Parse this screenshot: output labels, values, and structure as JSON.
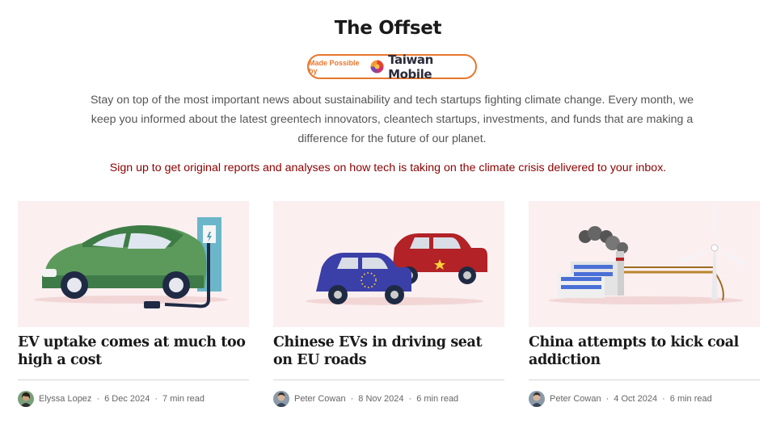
{
  "header": {
    "title": "The Offset",
    "sponsor": {
      "prefix": "Made Possible by",
      "brand": "Taiwan Mobile"
    }
  },
  "intro": "Stay on top of the most important news about sustainability and tech startups fighting climate change. Every month, we keep you informed about the latest greentech innovators, cleantech startups, investments, and funds that are making a difference for the future of our planet.",
  "cta": "Sign up to get original reports and analyses on how tech is taking on the climate crisis delivered to your inbox.",
  "articles": [
    {
      "headline": "EV uptake comes at much too high a cost",
      "author": "Elyssa Lopez",
      "date": "6 Dec 2024",
      "read_time": "7 min read",
      "sep": "·"
    },
    {
      "headline": "Chinese EVs in driving seat on EU roads",
      "author": "Peter Cowan",
      "date": "8 Nov 2024",
      "read_time": "6 min read",
      "sep": "·"
    },
    {
      "headline": "China attempts to kick coal addiction",
      "author": "Peter Cowan",
      "date": "4 Oct 2024",
      "read_time": "6 min read",
      "sep": "·"
    }
  ],
  "colors": {
    "accent": "#e8772e",
    "cta": "#8b0000",
    "thumb_bg": "#fbeff0"
  }
}
